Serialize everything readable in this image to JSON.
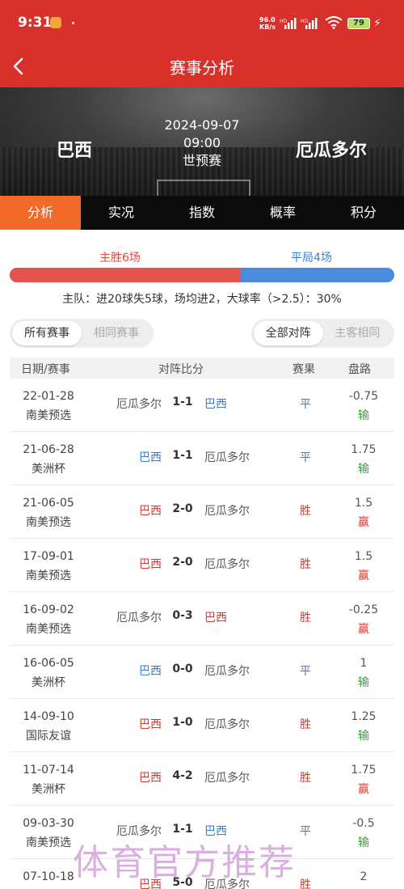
{
  "status": {
    "time": "9:31",
    "speed_top": "96.0",
    "speed_bottom": "KB/s",
    "battery": "79"
  },
  "nav": {
    "title": "赛事分析"
  },
  "match": {
    "home": "巴西",
    "away": "厄瓜多尔",
    "date": "2024-09-07",
    "time": "09:00",
    "competition": "世预赛"
  },
  "tabs": [
    "分析",
    "实况",
    "指数",
    "概率",
    "积分"
  ],
  "summary": {
    "win_label": "主胜6场",
    "draw_label": "平局4场",
    "win_share": 0.6,
    "stats": "主队：进20球失5球，场均进2，大球率（>2.5）：30%"
  },
  "filters": {
    "left": [
      "所有赛事",
      "相同赛事"
    ],
    "right": [
      "全部对阵",
      "主客相同"
    ]
  },
  "table": {
    "headers": [
      "日期/赛事",
      "对阵比分",
      "赛果",
      "盘路"
    ],
    "rows": [
      {
        "date": "22-01-28",
        "comp": "南美预选",
        "home": "厄瓜多尔",
        "score": "1-1",
        "away": "巴西",
        "result": "平",
        "line": "-0.75",
        "pan": "输",
        "brazil": "away"
      },
      {
        "date": "21-06-28",
        "comp": "美洲杯",
        "home": "巴西",
        "score": "1-1",
        "away": "厄瓜多尔",
        "result": "平",
        "line": "1.75",
        "pan": "输",
        "brazil": "home"
      },
      {
        "date": "21-06-05",
        "comp": "南美预选",
        "home": "巴西",
        "score": "2-0",
        "away": "厄瓜多尔",
        "result": "胜",
        "line": "1.5",
        "pan": "赢",
        "brazil": "home"
      },
      {
        "date": "17-09-01",
        "comp": "南美预选",
        "home": "巴西",
        "score": "2-0",
        "away": "厄瓜多尔",
        "result": "胜",
        "line": "1.5",
        "pan": "赢",
        "brazil": "home"
      },
      {
        "date": "16-09-02",
        "comp": "南美预选",
        "home": "厄瓜多尔",
        "score": "0-3",
        "away": "巴西",
        "result": "胜",
        "line": "-0.25",
        "pan": "赢",
        "brazil": "away"
      },
      {
        "date": "16-06-05",
        "comp": "美洲杯",
        "home": "巴西",
        "score": "0-0",
        "away": "厄瓜多尔",
        "result": "平",
        "line": "1",
        "pan": "输",
        "brazil": "home"
      },
      {
        "date": "14-09-10",
        "comp": "国际友谊",
        "home": "巴西",
        "score": "1-0",
        "away": "厄瓜多尔",
        "result": "胜",
        "line": "1.25",
        "pan": "输",
        "brazil": "home"
      },
      {
        "date": "11-07-14",
        "comp": "美洲杯",
        "home": "巴西",
        "score": "4-2",
        "away": "厄瓜多尔",
        "result": "胜",
        "line": "1.75",
        "pan": "赢",
        "brazil": "home"
      },
      {
        "date": "09-03-30",
        "comp": "南美预选",
        "home": "厄瓜多尔",
        "score": "1-1",
        "away": "巴西",
        "result": "平",
        "line": "-0.5",
        "pan": "输",
        "brazil": "away"
      },
      {
        "date": "07-10-18",
        "comp": "",
        "home": "巴西",
        "score": "5-0",
        "away": "厄瓜多尔",
        "result": "胜",
        "line": "2",
        "pan": "",
        "brazil": "home"
      }
    ]
  },
  "watermark": "体育官方推荐"
}
